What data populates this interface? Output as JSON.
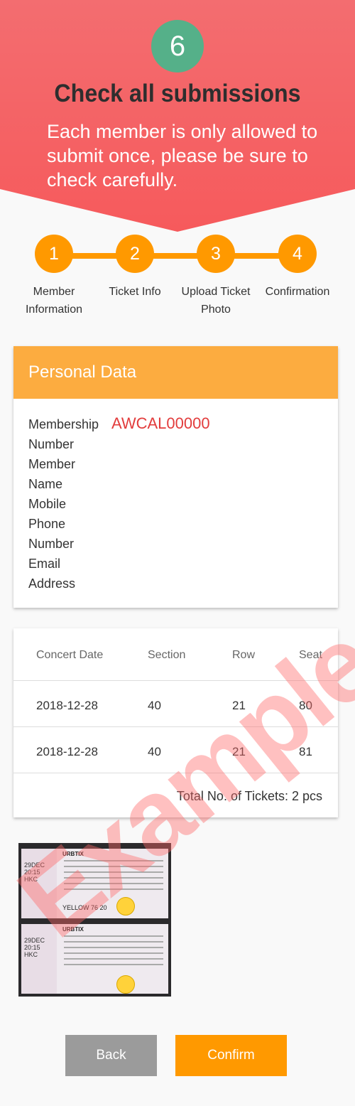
{
  "banner": {
    "step_number": "6",
    "title": "Check all submissions",
    "description": "Each member is only allowed to submit once,  please be sure to check carefully.",
    "colors": {
      "top": "#f36d70",
      "bottom": "#f65a5c",
      "circle": "#55b089"
    }
  },
  "stepper": {
    "color": "#ff9900",
    "steps": [
      {
        "number": "1",
        "label": "Member Information"
      },
      {
        "number": "2",
        "label": "Ticket Info"
      },
      {
        "number": "3",
        "label": "Upload Ticket Photo"
      },
      {
        "number": "4",
        "label": "Confirmation"
      }
    ]
  },
  "personal_data": {
    "header": "Personal Data",
    "header_color": "#fcac40",
    "labels": [
      "Membership",
      "Number",
      "Member",
      "Name",
      "Mobile",
      "Phone",
      "Number",
      "Email",
      "Address"
    ],
    "membership_number": "AWCAL00000"
  },
  "tickets": {
    "headers": [
      "Concert Date",
      "Section",
      "Row",
      "Seat"
    ],
    "rows": [
      [
        "2018-12-28",
        "40",
        "21",
        "80"
      ],
      [
        "2018-12-28",
        "40",
        "21",
        "81"
      ]
    ],
    "total": "Total No. of Tickets: 2 pcs"
  },
  "photo": {
    "ticket_brand": "URBTIX",
    "ticket_date": "29DEC",
    "ticket_time": "20:15",
    "ticket_venue": "HKC",
    "ticket_section": "YELLOW 76",
    "ticket_seat": "20"
  },
  "watermark": "Example",
  "buttons": {
    "back": "Back",
    "confirm": "Confirm"
  }
}
